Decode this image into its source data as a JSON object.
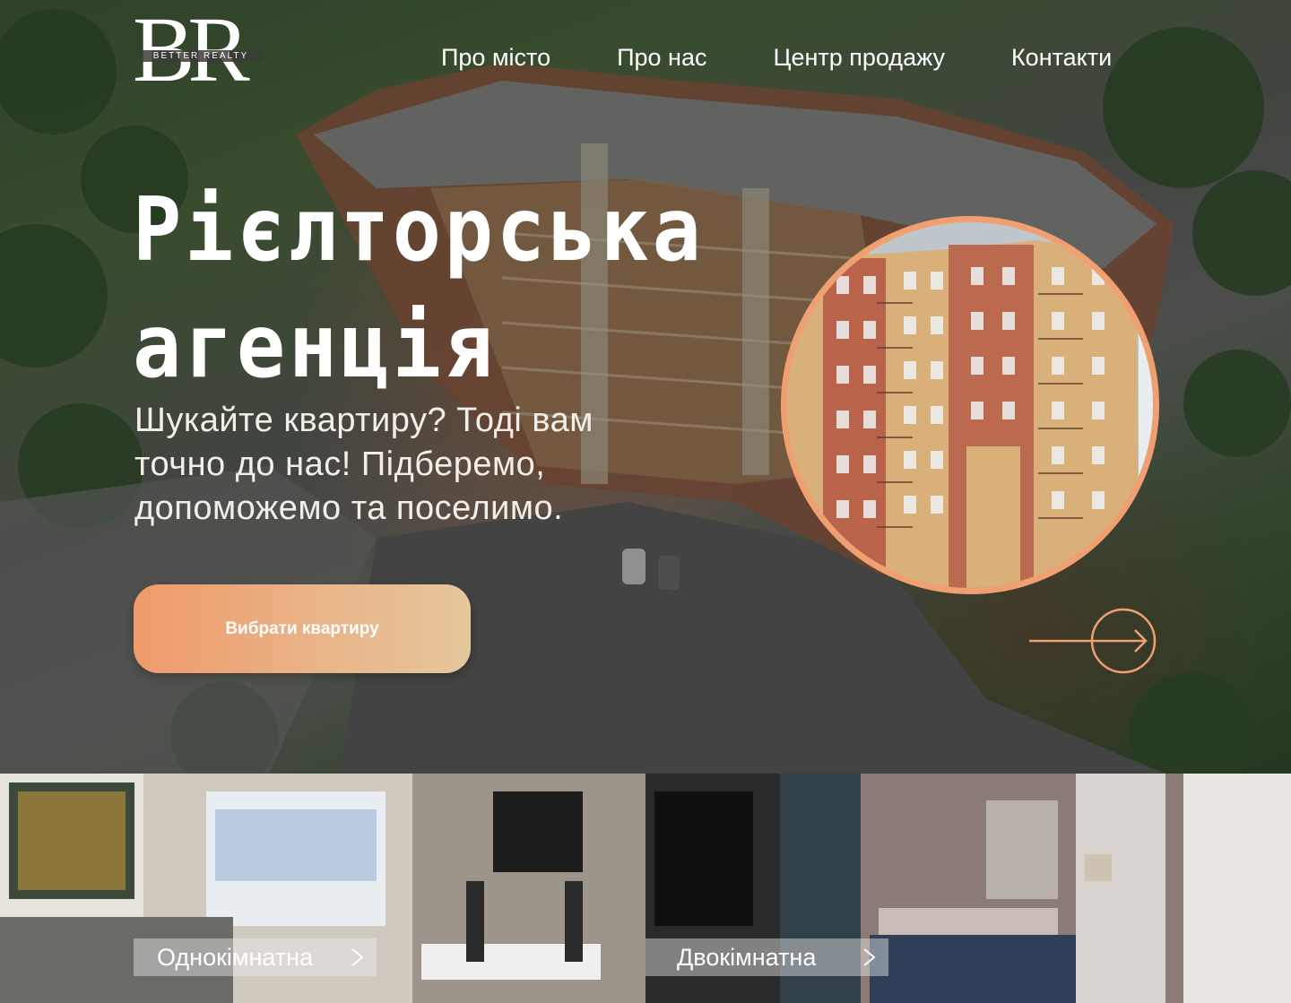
{
  "brand": {
    "logo_letters": "BR",
    "logo_tagline": "BETTER REALTY"
  },
  "nav": {
    "items": [
      "Про місто",
      "Про нас",
      "Центр продажу",
      "Контакти"
    ]
  },
  "hero": {
    "title_line1": "Рієлторська",
    "title_line2": "агенція",
    "subtitle": "Шукайте квартиру? Тоді вам точно до нас! Підберемо, допоможемо та поселимо.",
    "cta_label": "Вибрати квартиру",
    "accent_color": "#f0a070"
  },
  "cards": [
    {
      "label": "Однокімнатна"
    },
    {
      "label": "Двокімнатна"
    }
  ],
  "icons": {
    "next": "arrow-right-icon",
    "card_link": "chevron-right-icon"
  }
}
